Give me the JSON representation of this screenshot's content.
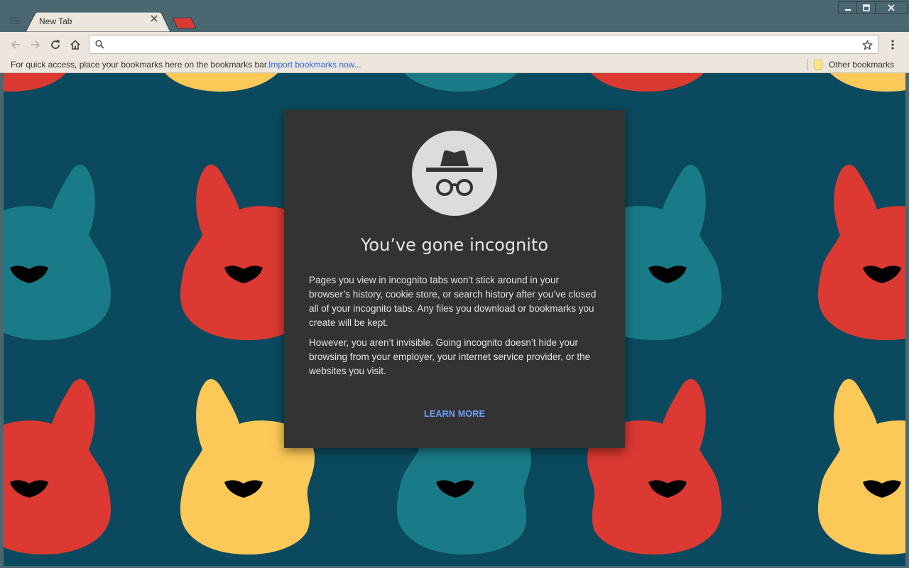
{
  "window": {
    "tab_title": "New Tab",
    "colors": {
      "frame": "#4a6772",
      "toolbar": "#ece6dc",
      "tab_accent": "#db3932"
    }
  },
  "toolbar": {
    "back_icon": "arrow-left-icon",
    "forward_icon": "arrow-right-icon",
    "reload_icon": "reload-icon",
    "home_icon": "home-icon",
    "omnibox_value": "",
    "search_icon": "search-icon",
    "bookmark_icon": "star-icon",
    "menu_icon": "more-vert-icon"
  },
  "bookmarks_bar": {
    "hint": "For quick access, place your bookmarks here on the bookmarks bar.",
    "import_link": "Import bookmarks now...",
    "other_bookmarks": "Other bookmarks"
  },
  "incognito_card": {
    "icon": "incognito-icon",
    "title": "You’ve gone incognito",
    "paragraph_1": "Pages you view in incognito tabs won’t stick around in your browser’s history, cookie store, or search history after you’ve closed all of your incognito tabs. Any files you download or bookmarks you create will be kept.",
    "paragraph_2": "However, you aren’t invisible. Going incognito doesn’t hide your browsing from your employer, your internet service provider, or the websites you visit.",
    "learn_more": "LEARN MORE",
    "colors": {
      "card_bg": "#333333",
      "link": "#6ea0f5",
      "page_bg": "#0b4a5e"
    }
  },
  "theme_pattern": {
    "colors": [
      "#db3932",
      "#fcc858",
      "#197b88"
    ],
    "nose_color": "#000000"
  }
}
